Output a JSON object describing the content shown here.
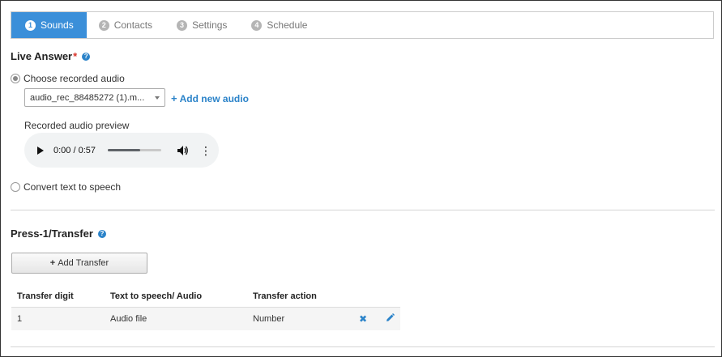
{
  "steps": [
    {
      "num": "1",
      "label": "Sounds",
      "active": true
    },
    {
      "num": "2",
      "label": "Contacts",
      "active": false
    },
    {
      "num": "3",
      "label": "Settings",
      "active": false
    },
    {
      "num": "4",
      "label": "Schedule",
      "active": false
    }
  ],
  "live_answer": {
    "title": "Live Answer",
    "required_mark": "*",
    "help_icon": "question-circle-icon",
    "option_recorded": "Choose recorded audio",
    "selected_audio": "audio_rec_88485272 (1).m...",
    "add_audio_label": "Add new audio",
    "preview_label": "Recorded audio preview",
    "player": {
      "time": "0:00 / 0:57",
      "progress_fraction": 0.6
    },
    "option_tts": "Convert text to speech"
  },
  "transfer": {
    "title": "Press-1/Transfer",
    "add_button": "Add Transfer",
    "columns": [
      "Transfer digit",
      "Text to speech/ Audio",
      "Transfer action"
    ],
    "rows": [
      {
        "digit": "1",
        "audio": "Audio file",
        "action": "Number"
      }
    ]
  },
  "colors": {
    "accent": "#3b8fd9",
    "link": "#2b83c9",
    "required": "#d9342b"
  }
}
